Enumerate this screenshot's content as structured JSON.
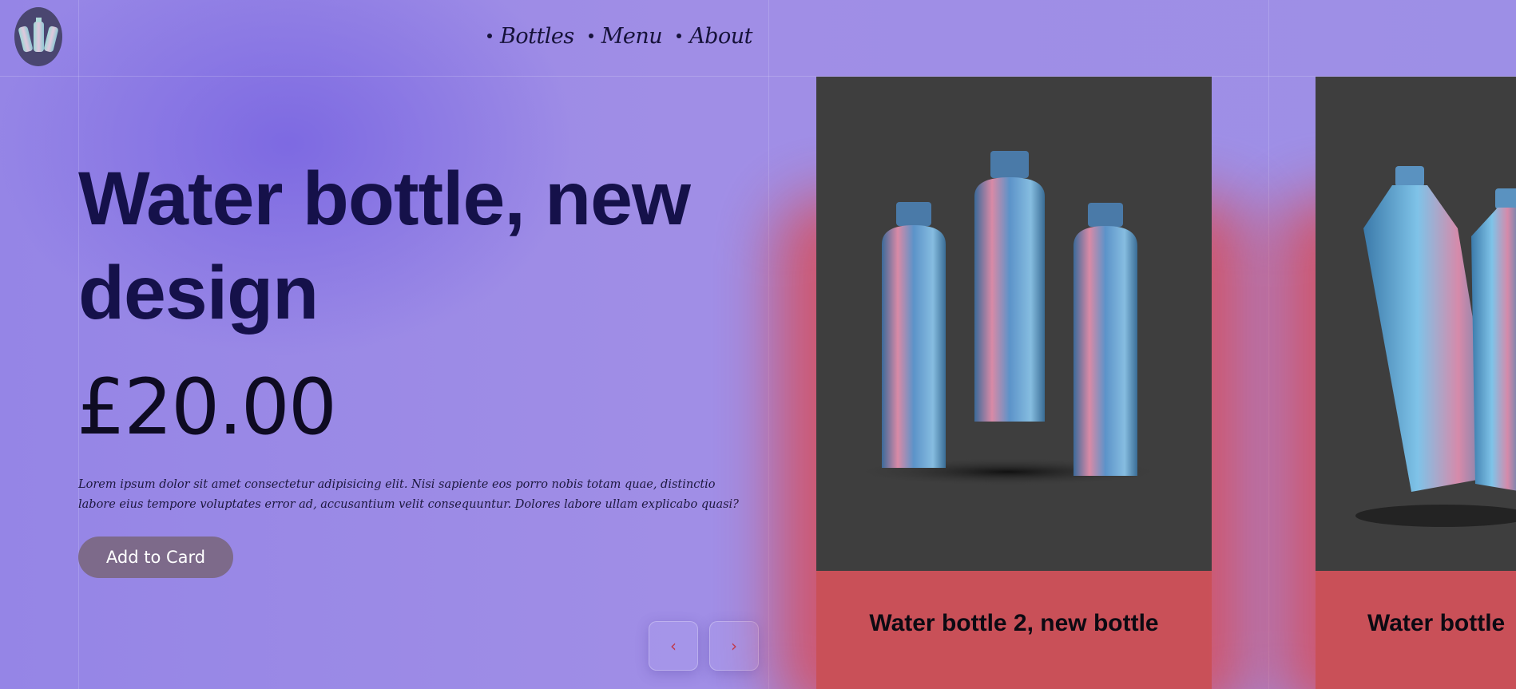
{
  "nav": {
    "items": [
      {
        "label": "Bottles"
      },
      {
        "label": "Menu"
      },
      {
        "label": "About"
      }
    ]
  },
  "hero": {
    "title": "Water bottle, new design",
    "price": "£20.00",
    "description": "Lorem ipsum dolor sit amet consectetur adipisicing elit. Nisi sapiente eos porro nobis totam quae, distinctio labore eius tempore voluptates error ad, accusantium velit consequuntur. Dolores labore ullam explicabo quasi?",
    "add_button": "Add to Card"
  },
  "carousel": {
    "prev_icon": "‹",
    "next_icon": "›"
  },
  "cards": [
    {
      "title": "Water bottle 2, new bottle"
    },
    {
      "title": "Water bottle"
    }
  ],
  "colors": {
    "background": "#9d8ee6",
    "title": "#15114a",
    "button": "#7d6a8a",
    "card_panel": "#c95058",
    "image_bg": "#3e3e3e"
  }
}
